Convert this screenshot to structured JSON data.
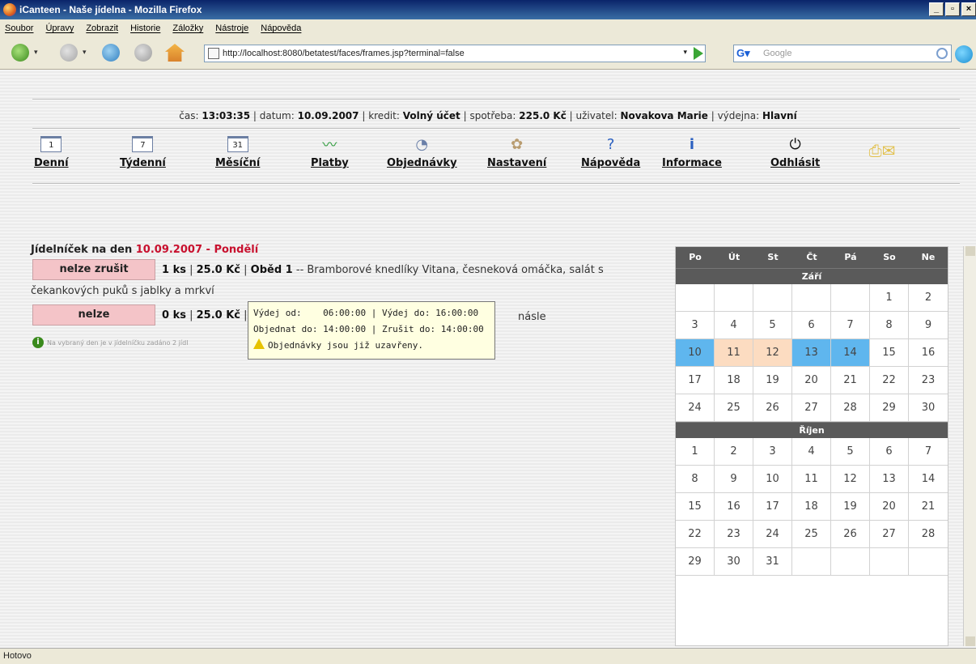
{
  "window": {
    "title": "iCanteen - Naše jídelna - Mozilla Firefox"
  },
  "menubar": [
    "Soubor",
    "Úpravy",
    "Zobrazit",
    "Historie",
    "Záložky",
    "Nástroje",
    "Nápověda"
  ],
  "navbar": {
    "url": "http://localhost:8080/betatest/faces/frames.jsp?terminal=false",
    "search_placeholder": "Google"
  },
  "status": {
    "cas_label": "čas:",
    "cas": "13:03:35",
    "datum_label": "datum:",
    "datum": "10.09.2007",
    "kredit_label": "kredit:",
    "kredit": "Volný účet",
    "spotreba_label": "spotřeba:",
    "spotreba": "225.0 Kč",
    "uzivatel_label": "uživatel:",
    "uzivatel": "Novakova Marie",
    "vydejna_label": "výdejna:",
    "vydejna": "Hlavní"
  },
  "toolbar": {
    "denni": "Denní",
    "denni_num": "1",
    "tydenni": "Týdenní",
    "tydenni_num": "7",
    "mesicni": "Měsíční",
    "mesicni_num": "31",
    "platby": "Platby",
    "objednavky": "Objednávky",
    "nastaveni": "Nastavení",
    "napoveda": "Nápověda",
    "informace": "Informace",
    "odhlasit": "Odhlásit"
  },
  "menu": {
    "title_prefix": "Jídelníček na den",
    "date": "10.09.2007",
    "dash": "-",
    "day": "Pondělí",
    "row1": {
      "button": "nelze zrušit",
      "qty": "1 ks",
      "price": "25.0 Kč",
      "meal": "Oběd 1",
      "desc": "-- Bramborové knedlíky Vitana, česneková omáčka, salát s",
      "desc2": "čekankových puků s jablky a mrkví"
    },
    "row2": {
      "button": "nelze",
      "qty": "0 ks",
      "price": "25.0 Kč",
      "trail": "násle"
    },
    "note": "Na vybraný den je v jídelníčku zadáno 2 jídl"
  },
  "tooltip": {
    "line1": "Výdej od:    06:00:00 | Výdej do: 16:00:00",
    "line2": "Objednat do: 14:00:00 | Zrušit do: 14:00:00",
    "line3": "Objednávky jsou již uzavřeny."
  },
  "calendar": {
    "weekdays": [
      "Po",
      "Út",
      "St",
      "Čt",
      "Pá",
      "So",
      "Ne"
    ],
    "month1": "Září",
    "month1_days": [
      "",
      "",
      "",
      "",
      "",
      "1",
      "2",
      "3",
      "4",
      "5",
      "6",
      "7",
      "8",
      "9",
      "10",
      "11",
      "12",
      "13",
      "14",
      "15",
      "16",
      "17",
      "18",
      "19",
      "20",
      "21",
      "22",
      "23",
      "24",
      "25",
      "26",
      "27",
      "28",
      "29",
      "30"
    ],
    "month2": "Říjen",
    "month2_days": [
      "1",
      "2",
      "3",
      "4",
      "5",
      "6",
      "7",
      "8",
      "9",
      "10",
      "11",
      "12",
      "13",
      "14",
      "15",
      "16",
      "17",
      "18",
      "19",
      "20",
      "21",
      "22",
      "23",
      "24",
      "25",
      "26",
      "27",
      "28",
      "29",
      "30",
      "31",
      "",
      "",
      "",
      ""
    ],
    "blue_days": [
      "10",
      "13",
      "14"
    ],
    "peach_days": [
      "11",
      "12"
    ],
    "blue_color": "#5fb6ee",
    "peach_color": "#fcdcc1"
  },
  "statusbar": "Hotovo"
}
